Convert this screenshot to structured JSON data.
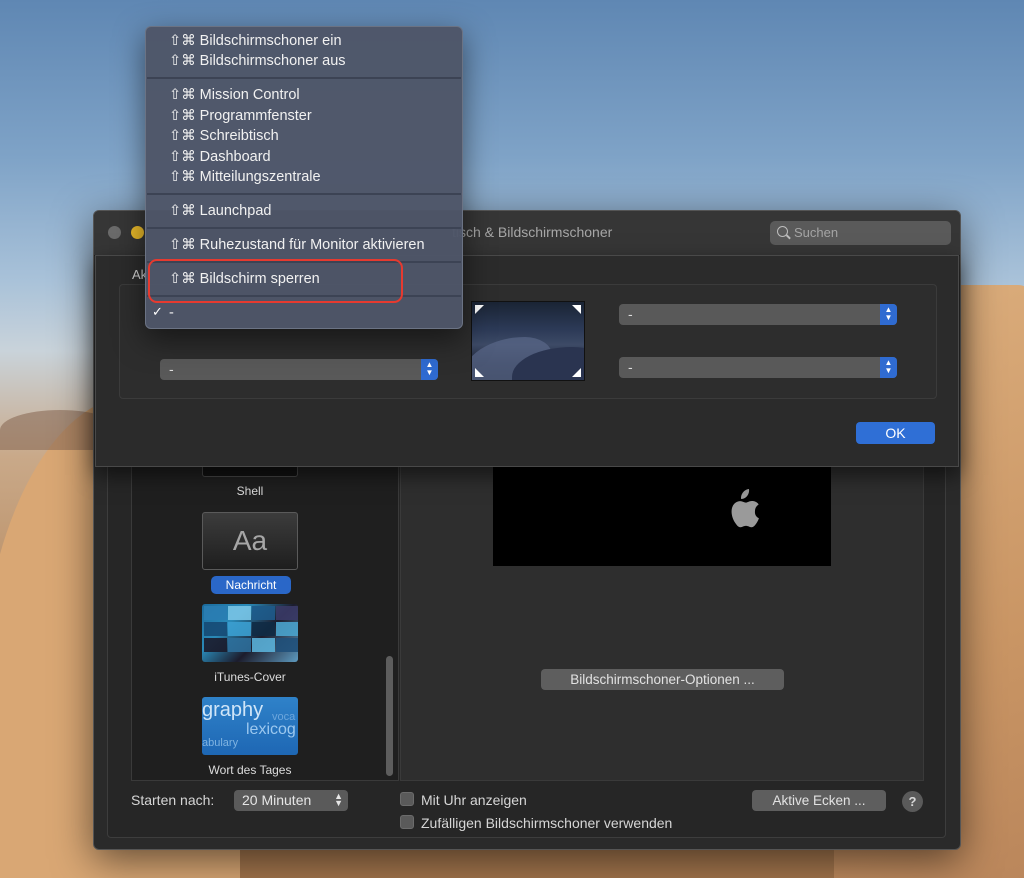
{
  "window": {
    "title": "tisch & Bildschirmschoner",
    "search_placeholder": "Suchen"
  },
  "saver_list": {
    "items": [
      {
        "label": "Shell"
      },
      {
        "label": "Nachricht",
        "thumb_text": "Aa",
        "selected": true
      },
      {
        "label": "iTunes-Cover"
      },
      {
        "label": "Wort des Tages",
        "thumb_words": [
          "graphy",
          "lexicog",
          "abulary",
          "voca"
        ]
      }
    ]
  },
  "preview": {
    "options_button": "Bildschirmschoner-Optionen ..."
  },
  "footer": {
    "start_after_label": "Starten nach:",
    "start_after_value": "20 Minuten",
    "show_clock_label": "Mit Uhr anzeigen",
    "random_label": "Zufälligen Bildschirmschoner verwenden",
    "hot_corners_button": "Aktive Ecken ...",
    "help_label": "?"
  },
  "sheet": {
    "heading": "Ak",
    "corner_top_left_value": "-",
    "corner_bottom_left_value": "-",
    "corner_top_right_value": "-",
    "corner_bottom_right_value": "-",
    "ok_button": "OK",
    "accent_color": "#2f6fd6"
  },
  "menu": {
    "groups": [
      [
        "⇧⌘ Bildschirmschoner ein",
        "⇧⌘ Bildschirmschoner aus"
      ],
      [
        "⇧⌘ Mission Control",
        "⇧⌘ Programmfenster",
        "⇧⌘ Schreibtisch",
        "⇧⌘ Dashboard",
        "⇧⌘ Mitteilungszentrale"
      ],
      [
        "⇧⌘ Launchpad"
      ],
      [
        "⇧⌘ Ruhezustand für Monitor aktivieren"
      ],
      [
        "⇧⌘ Bildschirm sperren"
      ],
      [
        "-"
      ]
    ],
    "checkmark": "✓",
    "checked_item": "-",
    "highlighted_item": "⇧⌘ Bildschirm sperren",
    "highlight_color": "#e63a2f"
  }
}
